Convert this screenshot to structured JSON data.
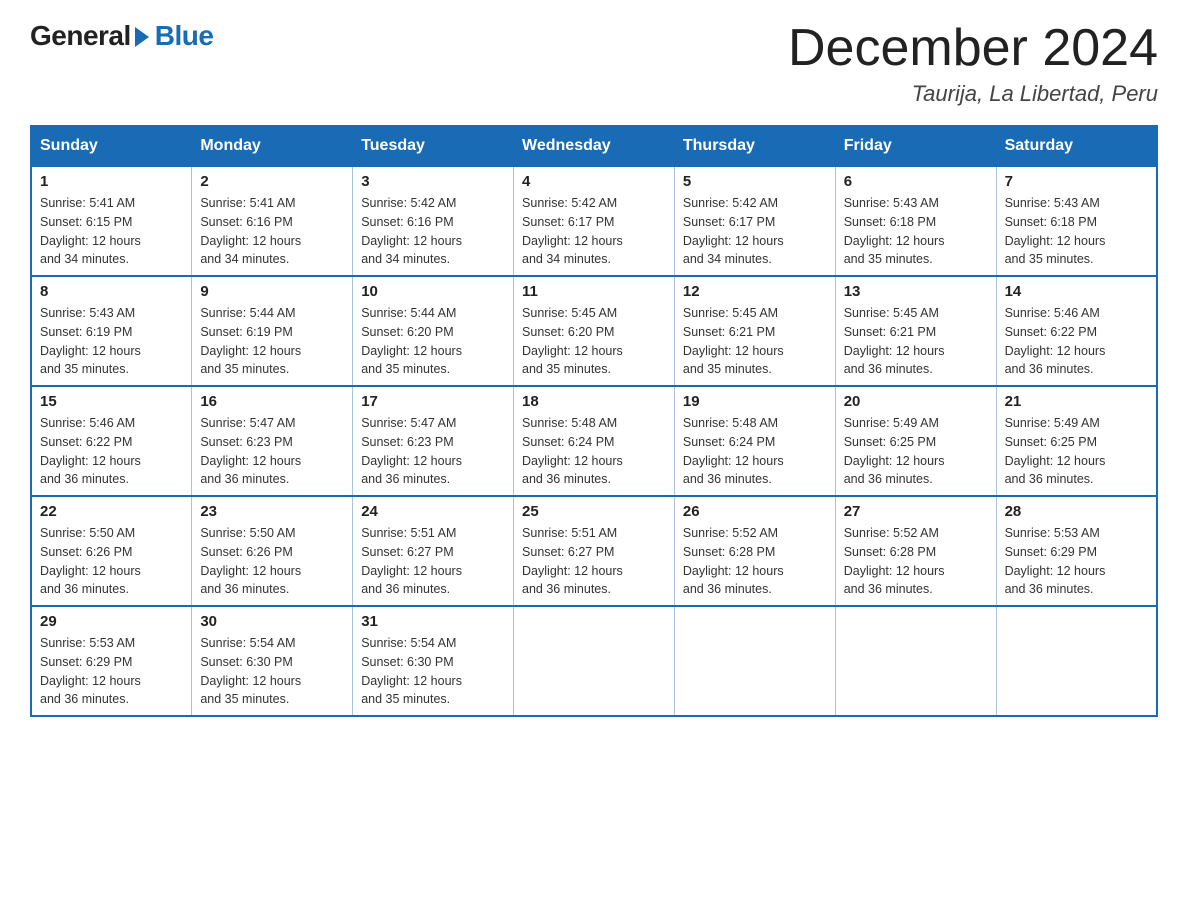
{
  "logo": {
    "general": "General",
    "blue": "Blue"
  },
  "title": "December 2024",
  "subtitle": "Taurija, La Libertad, Peru",
  "days_of_week": [
    "Sunday",
    "Monday",
    "Tuesday",
    "Wednesday",
    "Thursday",
    "Friday",
    "Saturday"
  ],
  "weeks": [
    [
      {
        "day": "1",
        "info": "Sunrise: 5:41 AM\nSunset: 6:15 PM\nDaylight: 12 hours\nand 34 minutes."
      },
      {
        "day": "2",
        "info": "Sunrise: 5:41 AM\nSunset: 6:16 PM\nDaylight: 12 hours\nand 34 minutes."
      },
      {
        "day": "3",
        "info": "Sunrise: 5:42 AM\nSunset: 6:16 PM\nDaylight: 12 hours\nand 34 minutes."
      },
      {
        "day": "4",
        "info": "Sunrise: 5:42 AM\nSunset: 6:17 PM\nDaylight: 12 hours\nand 34 minutes."
      },
      {
        "day": "5",
        "info": "Sunrise: 5:42 AM\nSunset: 6:17 PM\nDaylight: 12 hours\nand 34 minutes."
      },
      {
        "day": "6",
        "info": "Sunrise: 5:43 AM\nSunset: 6:18 PM\nDaylight: 12 hours\nand 35 minutes."
      },
      {
        "day": "7",
        "info": "Sunrise: 5:43 AM\nSunset: 6:18 PM\nDaylight: 12 hours\nand 35 minutes."
      }
    ],
    [
      {
        "day": "8",
        "info": "Sunrise: 5:43 AM\nSunset: 6:19 PM\nDaylight: 12 hours\nand 35 minutes."
      },
      {
        "day": "9",
        "info": "Sunrise: 5:44 AM\nSunset: 6:19 PM\nDaylight: 12 hours\nand 35 minutes."
      },
      {
        "day": "10",
        "info": "Sunrise: 5:44 AM\nSunset: 6:20 PM\nDaylight: 12 hours\nand 35 minutes."
      },
      {
        "day": "11",
        "info": "Sunrise: 5:45 AM\nSunset: 6:20 PM\nDaylight: 12 hours\nand 35 minutes."
      },
      {
        "day": "12",
        "info": "Sunrise: 5:45 AM\nSunset: 6:21 PM\nDaylight: 12 hours\nand 35 minutes."
      },
      {
        "day": "13",
        "info": "Sunrise: 5:45 AM\nSunset: 6:21 PM\nDaylight: 12 hours\nand 36 minutes."
      },
      {
        "day": "14",
        "info": "Sunrise: 5:46 AM\nSunset: 6:22 PM\nDaylight: 12 hours\nand 36 minutes."
      }
    ],
    [
      {
        "day": "15",
        "info": "Sunrise: 5:46 AM\nSunset: 6:22 PM\nDaylight: 12 hours\nand 36 minutes."
      },
      {
        "day": "16",
        "info": "Sunrise: 5:47 AM\nSunset: 6:23 PM\nDaylight: 12 hours\nand 36 minutes."
      },
      {
        "day": "17",
        "info": "Sunrise: 5:47 AM\nSunset: 6:23 PM\nDaylight: 12 hours\nand 36 minutes."
      },
      {
        "day": "18",
        "info": "Sunrise: 5:48 AM\nSunset: 6:24 PM\nDaylight: 12 hours\nand 36 minutes."
      },
      {
        "day": "19",
        "info": "Sunrise: 5:48 AM\nSunset: 6:24 PM\nDaylight: 12 hours\nand 36 minutes."
      },
      {
        "day": "20",
        "info": "Sunrise: 5:49 AM\nSunset: 6:25 PM\nDaylight: 12 hours\nand 36 minutes."
      },
      {
        "day": "21",
        "info": "Sunrise: 5:49 AM\nSunset: 6:25 PM\nDaylight: 12 hours\nand 36 minutes."
      }
    ],
    [
      {
        "day": "22",
        "info": "Sunrise: 5:50 AM\nSunset: 6:26 PM\nDaylight: 12 hours\nand 36 minutes."
      },
      {
        "day": "23",
        "info": "Sunrise: 5:50 AM\nSunset: 6:26 PM\nDaylight: 12 hours\nand 36 minutes."
      },
      {
        "day": "24",
        "info": "Sunrise: 5:51 AM\nSunset: 6:27 PM\nDaylight: 12 hours\nand 36 minutes."
      },
      {
        "day": "25",
        "info": "Sunrise: 5:51 AM\nSunset: 6:27 PM\nDaylight: 12 hours\nand 36 minutes."
      },
      {
        "day": "26",
        "info": "Sunrise: 5:52 AM\nSunset: 6:28 PM\nDaylight: 12 hours\nand 36 minutes."
      },
      {
        "day": "27",
        "info": "Sunrise: 5:52 AM\nSunset: 6:28 PM\nDaylight: 12 hours\nand 36 minutes."
      },
      {
        "day": "28",
        "info": "Sunrise: 5:53 AM\nSunset: 6:29 PM\nDaylight: 12 hours\nand 36 minutes."
      }
    ],
    [
      {
        "day": "29",
        "info": "Sunrise: 5:53 AM\nSunset: 6:29 PM\nDaylight: 12 hours\nand 36 minutes."
      },
      {
        "day": "30",
        "info": "Sunrise: 5:54 AM\nSunset: 6:30 PM\nDaylight: 12 hours\nand 35 minutes."
      },
      {
        "day": "31",
        "info": "Sunrise: 5:54 AM\nSunset: 6:30 PM\nDaylight: 12 hours\nand 35 minutes."
      },
      null,
      null,
      null,
      null
    ]
  ]
}
